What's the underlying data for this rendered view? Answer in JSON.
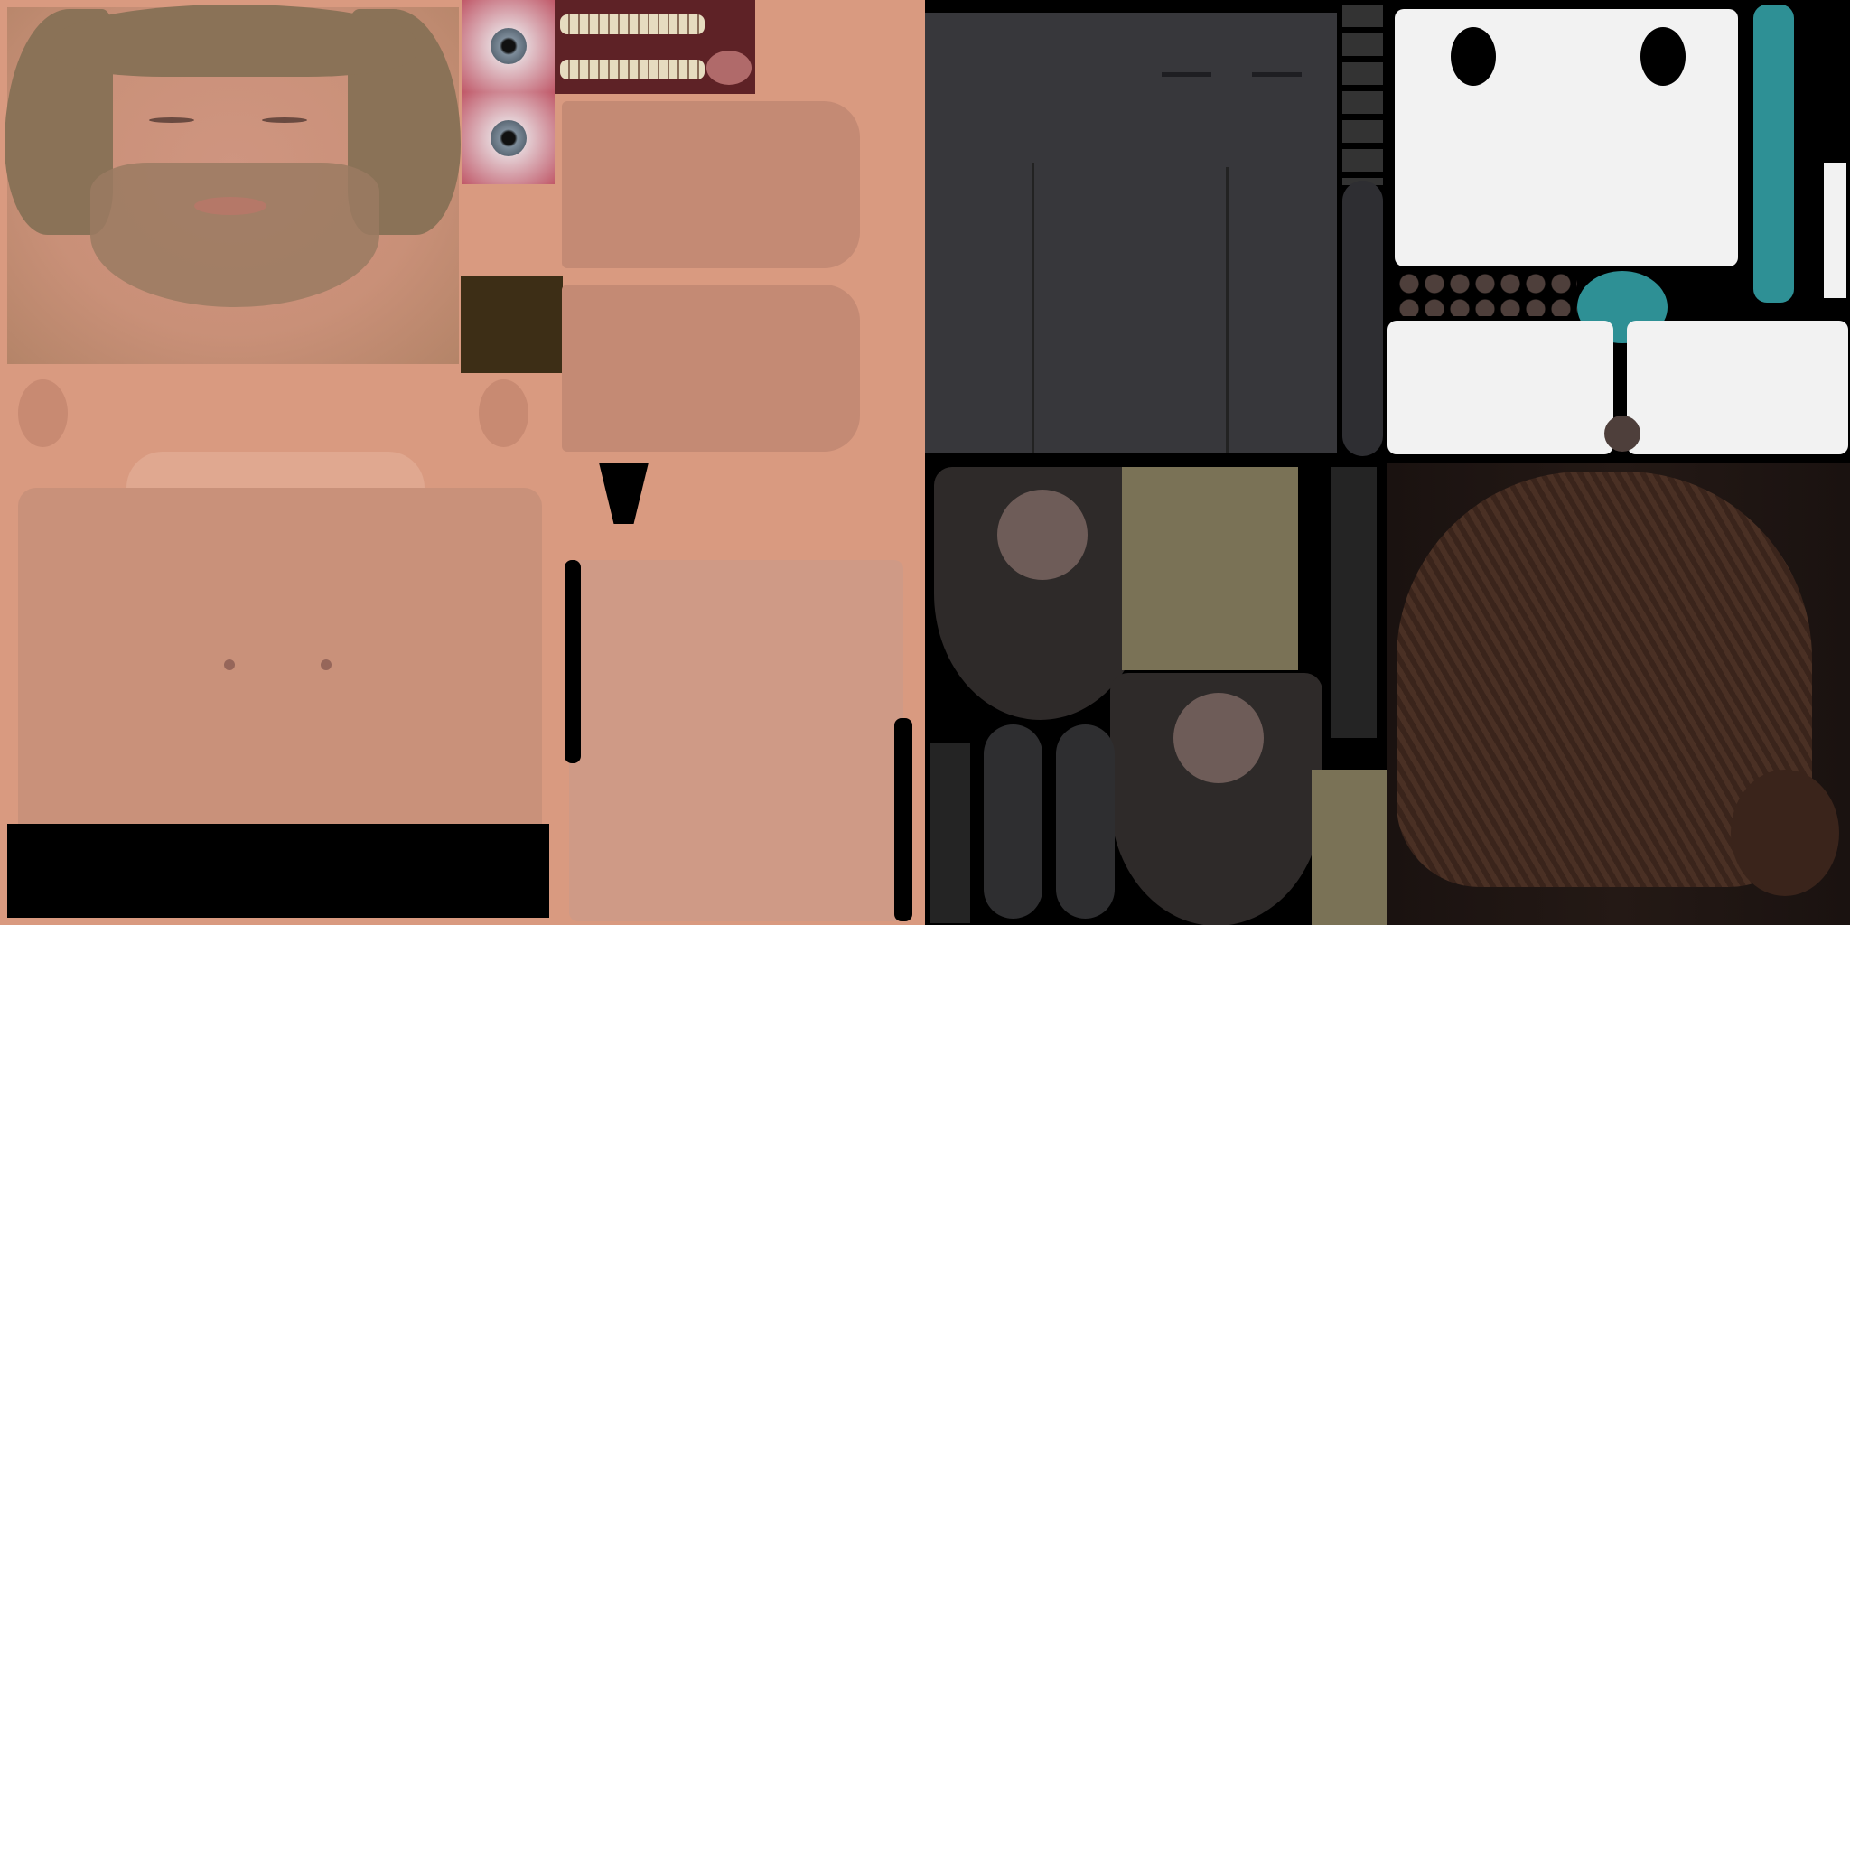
{
  "colors": {
    "skin": "#d99a80",
    "beard": "#8a6a52",
    "mouth_bg": "#5e2226",
    "teeth": "#e6dcc0",
    "iris": "#7d8c9a",
    "eye_bg": "#e8c4c8",
    "pants": "#37373b",
    "shirt": "#f2f2f2",
    "teal": "#2e9095",
    "button": "#4e3f3b",
    "shoe": "#2e2a29",
    "shoe_leather": "#6e5c58",
    "khaki": "#7a7256",
    "hair": "#4a3024",
    "background": "#000000",
    "page": "#ffffff"
  }
}
